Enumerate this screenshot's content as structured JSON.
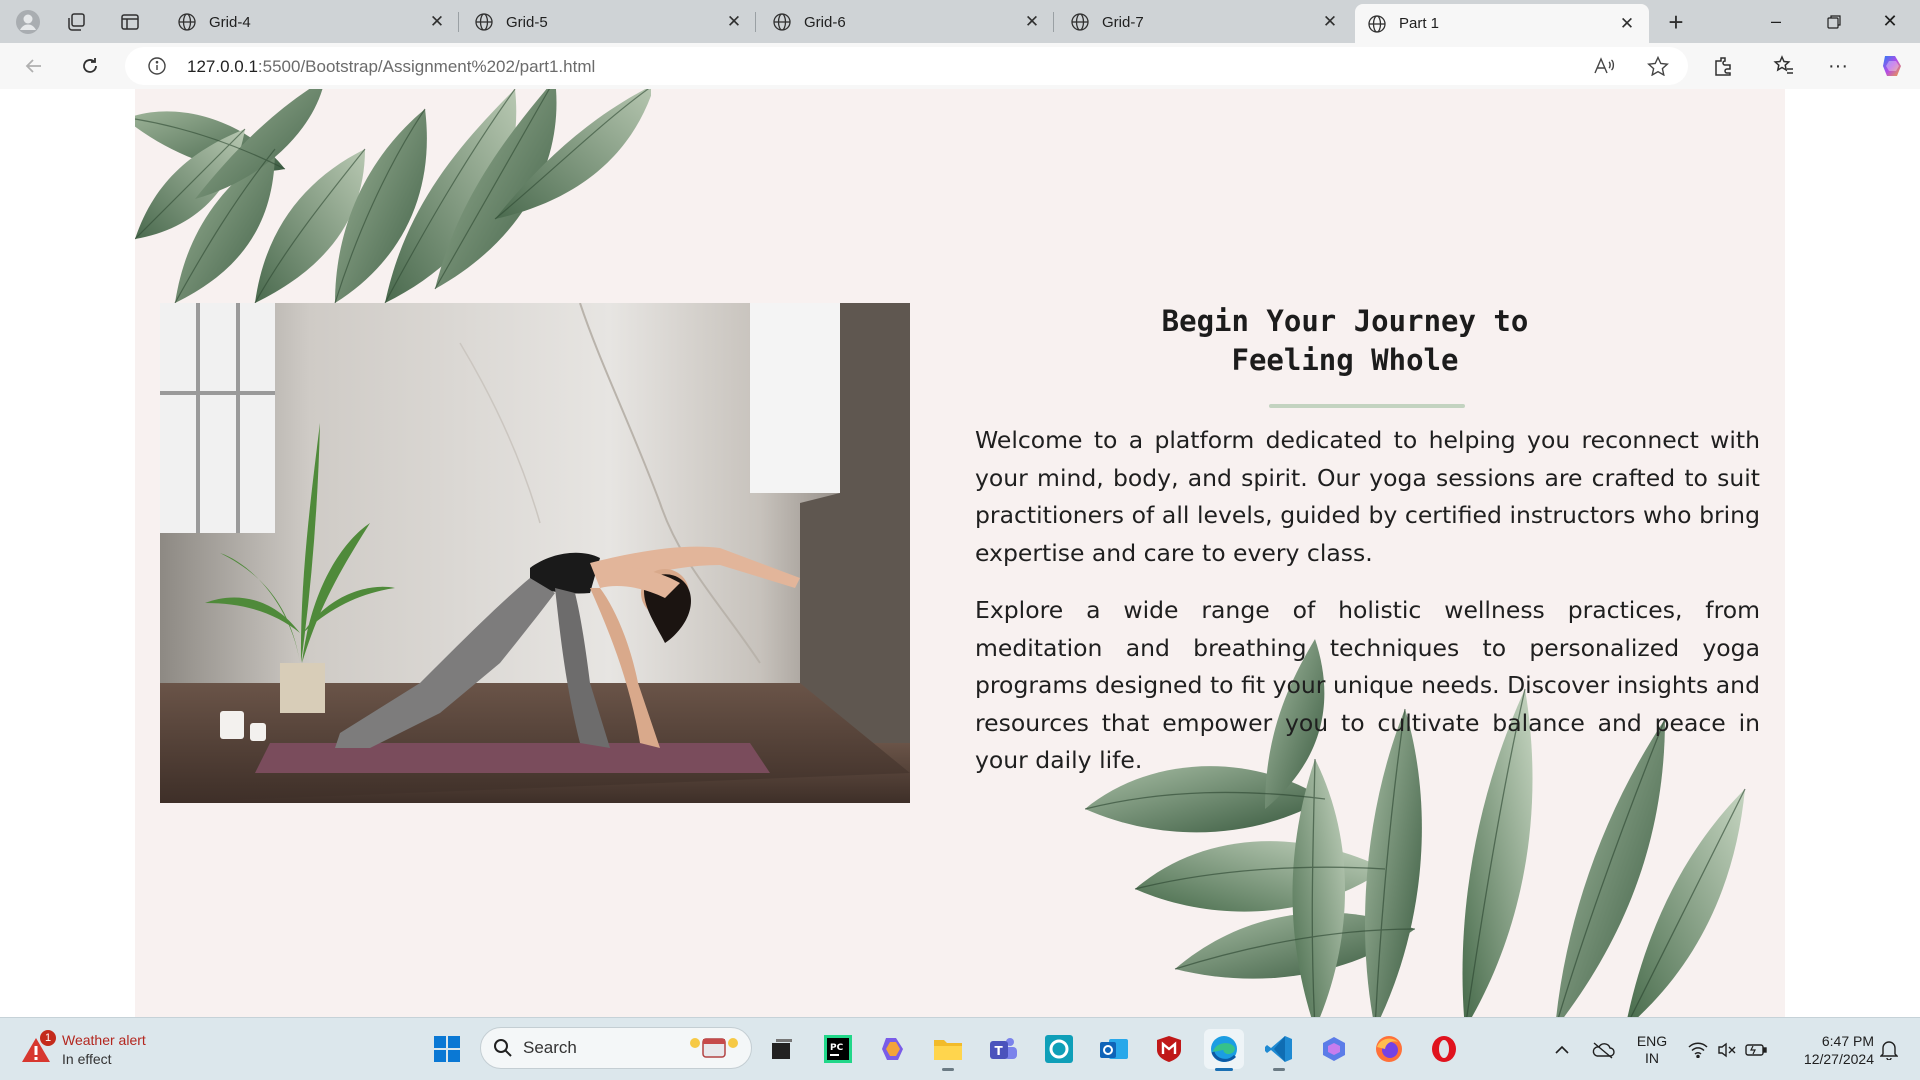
{
  "browser": {
    "tabs": [
      {
        "title": "Grid-4",
        "active": false
      },
      {
        "title": "Grid-5",
        "active": false
      },
      {
        "title": "Grid-6",
        "active": false
      },
      {
        "title": "Grid-7",
        "active": false
      },
      {
        "title": "Part 1",
        "active": true
      }
    ],
    "url_host": "127.0.0.1",
    "url_rest": ":5500/Bootstrap/Assignment%202/part1.html"
  },
  "page": {
    "heading_line1": "Begin Your Journey to",
    "heading_line2": "Feeling Whole",
    "paragraph1": "Welcome to a platform dedicated to helping you reconnect with your mind, body, and spirit. Our yoga sessions are crafted to suit practitioners of all levels, guided by certified instructors who bring expertise and care to every class.",
    "paragraph2": "Explore a wide range of holistic wellness practices, from meditation and breathing techniques to personalized yoga programs designed to fit your unique needs. Discover insights and resources that empower you to cultivate balance and peace in your daily life.",
    "accent_color": "#c3d3c0",
    "background_color": "#f8f1f0"
  },
  "taskbar": {
    "weather_title": "Weather alert",
    "weather_status": "In effect",
    "weather_badge": "1",
    "search_placeholder": "Search",
    "lang_line1": "ENG",
    "lang_line2": "IN",
    "time": "6:47 PM",
    "date": "12/27/2024"
  }
}
